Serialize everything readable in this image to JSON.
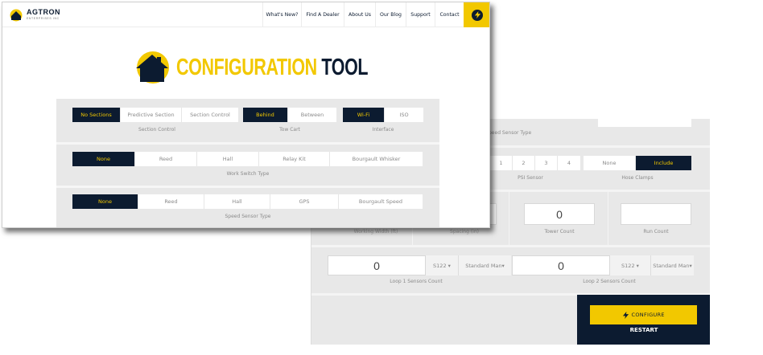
{
  "nav": {
    "brand_line1": "AGTRON",
    "brand_line2": "ENTERPRISES INC",
    "items": [
      "What's New?",
      "Find A Dealer",
      "About Us",
      "Our Blog",
      "Support",
      "Contact"
    ]
  },
  "hero": {
    "title_yellow": "CONFIGURATION",
    "title_navy": "TOOL"
  },
  "front": {
    "section_control": {
      "options": [
        "No Sections",
        "Predictive Section",
        "Section Control"
      ],
      "selected": 0,
      "label": "Section Control"
    },
    "tow_cart": {
      "options": [
        "Behind",
        "Between"
      ],
      "selected": 0,
      "label": "Tow Cart"
    },
    "interface": {
      "options": [
        "Wi-Fi",
        "ISO"
      ],
      "selected": 0,
      "label": "Interface"
    },
    "work_switch": {
      "options": [
        "None",
        "Reed",
        "Hall",
        "Relay Kit",
        "Bourgault Whisker"
      ],
      "selected": 0,
      "label": "Work Switch Type"
    },
    "speed_sensor": {
      "options": [
        "None",
        "Reed",
        "Hall",
        "GPS",
        "Bourgault Speed"
      ],
      "selected": 0,
      "label": "Speed Sensor Type"
    }
  },
  "back": {
    "speed_sensor_label_partial": "peed Sensor Type",
    "psi_sensor": {
      "options": [
        "1",
        "2",
        "3",
        "4"
      ],
      "label": "PSI Sensor"
    },
    "hose_clamps": {
      "options": [
        "None",
        "Include"
      ],
      "selected": 1,
      "label": "Hose Clamps"
    },
    "counts": {
      "partial_left_label": "Working Width (ft)",
      "partial_mid_label": "Spacing (in)",
      "tower_value": "0",
      "tower_label": "Tower Count",
      "run_value": "",
      "run_label": "Run Count"
    },
    "loop1": {
      "value": "0",
      "size": "S122",
      "type": "Standard Man",
      "label": "Loop 1 Sensors Count"
    },
    "loop2": {
      "value": "0",
      "size": "S122",
      "type": "Standard Man",
      "label": "Loop 2 Sensors Count"
    },
    "configure_label": "CONFIGURE",
    "restart_label": "RESTART"
  },
  "colors": {
    "navy": "#0c1b30",
    "yellow": "#f2c800",
    "panel": "#e8e8e8"
  },
  "icons": [
    "agtron-logo-icon",
    "house-icon",
    "bolt-icon"
  ]
}
